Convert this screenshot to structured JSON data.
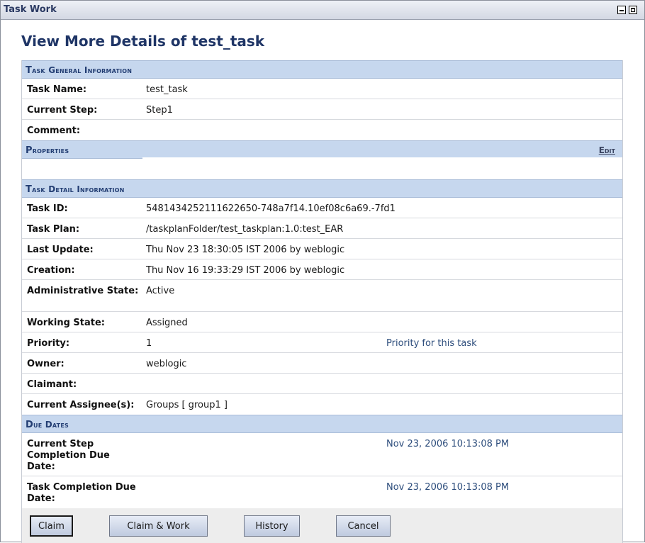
{
  "window": {
    "title": "Task Work"
  },
  "page": {
    "title": "View More Details of test_task"
  },
  "general": {
    "header": "Task General Information",
    "rows": [
      {
        "label": "Task Name:",
        "value": "test_task"
      },
      {
        "label": "Current Step:",
        "value": "Step1"
      },
      {
        "label": "Comment:",
        "value": ""
      }
    ]
  },
  "properties": {
    "header": "Properties",
    "edit_label": "Edit"
  },
  "detail": {
    "header": "Task Detail Information",
    "task_id_label": "Task ID:",
    "task_id": "5481434252111622650-748a7f14.10ef08c6a69.-7fd1",
    "plan_label": "Task Plan:",
    "plan": "/taskplanFolder/test_taskplan:1.0:test_EAR",
    "last_update_label": "Last Update:",
    "last_update": "Thu Nov 23 18:30:05 IST 2006 by weblogic",
    "creation_label": "Creation:",
    "creation": "Thu Nov 16 19:33:29 IST 2006 by weblogic",
    "admin_state_label": "Administrative State:",
    "admin_state": "Active",
    "working_state_label": "Working State:",
    "working_state": "Assigned",
    "priority_label": "Priority:",
    "priority": "1",
    "priority_note": "Priority for this task",
    "owner_label": "Owner:",
    "owner": "weblogic",
    "claimant_label": "Claimant:",
    "claimant": "",
    "assignees_label": "Current Assignee(s):",
    "assignees": "Groups [ group1 ]"
  },
  "due": {
    "header": "Due Dates",
    "step_label": "Current Step Completion Due Date:",
    "step_value": "Nov 23, 2006 10:13:08 PM",
    "task_label": "Task Completion Due Date:",
    "task_value": "Nov 23, 2006 10:13:08 PM"
  },
  "buttons": {
    "claim": "Claim",
    "claim_work": "Claim & Work",
    "history": "History",
    "cancel": "Cancel"
  }
}
